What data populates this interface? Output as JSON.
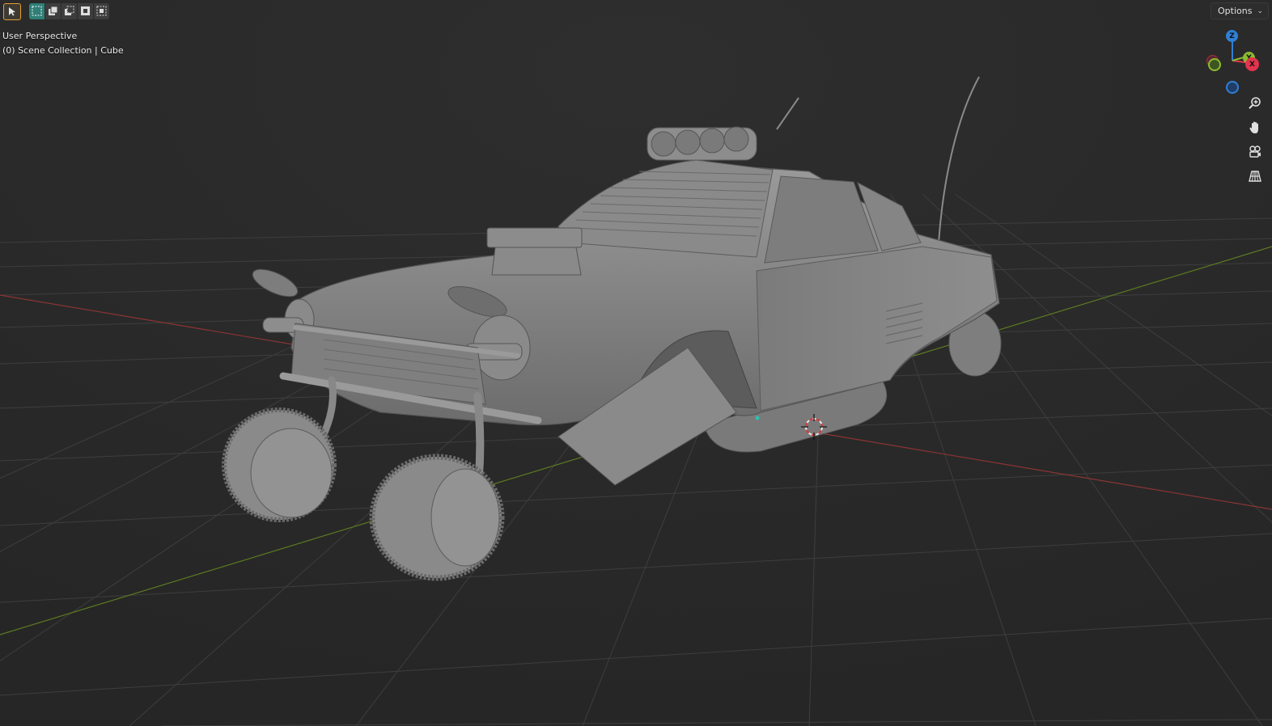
{
  "viewport": {
    "view_name": "User Perspective",
    "collection_info": "(0) Scene Collection | Cube"
  },
  "header": {
    "options_label": "Options"
  },
  "toolbar": {
    "tools": [
      {
        "name": "select-tool",
        "icon": "cursor-arrow-icon",
        "active": true
      }
    ],
    "selection_modes": [
      {
        "name": "select-new",
        "icon": "box-select-new-icon",
        "active": true
      },
      {
        "name": "select-extend",
        "icon": "box-select-extend-icon",
        "active": false
      },
      {
        "name": "select-subtract",
        "icon": "box-select-subtract-icon",
        "active": false
      },
      {
        "name": "select-invert",
        "icon": "box-select-invert-icon",
        "active": false
      },
      {
        "name": "select-intersect",
        "icon": "box-select-intersect-icon",
        "active": false
      }
    ]
  },
  "gizmo": {
    "z_label": "Z",
    "y_label": "Y",
    "x_label": "X",
    "colors": {
      "x": "#e3344d",
      "y": "#8bbc2f",
      "z": "#2f7fd6"
    }
  },
  "nav_tools": [
    {
      "name": "zoom",
      "icon": "zoom-icon"
    },
    {
      "name": "pan",
      "icon": "hand-icon"
    },
    {
      "name": "camera-view",
      "icon": "camera-icon"
    },
    {
      "name": "toggle-projection",
      "icon": "perspective-grid-icon"
    }
  ],
  "colors": {
    "background": "#2b2b2b",
    "grid": "#3c3c3c",
    "x_axis": "#9a3b3b",
    "y_axis": "#5f7a2a",
    "model": "#8f8f8f"
  }
}
